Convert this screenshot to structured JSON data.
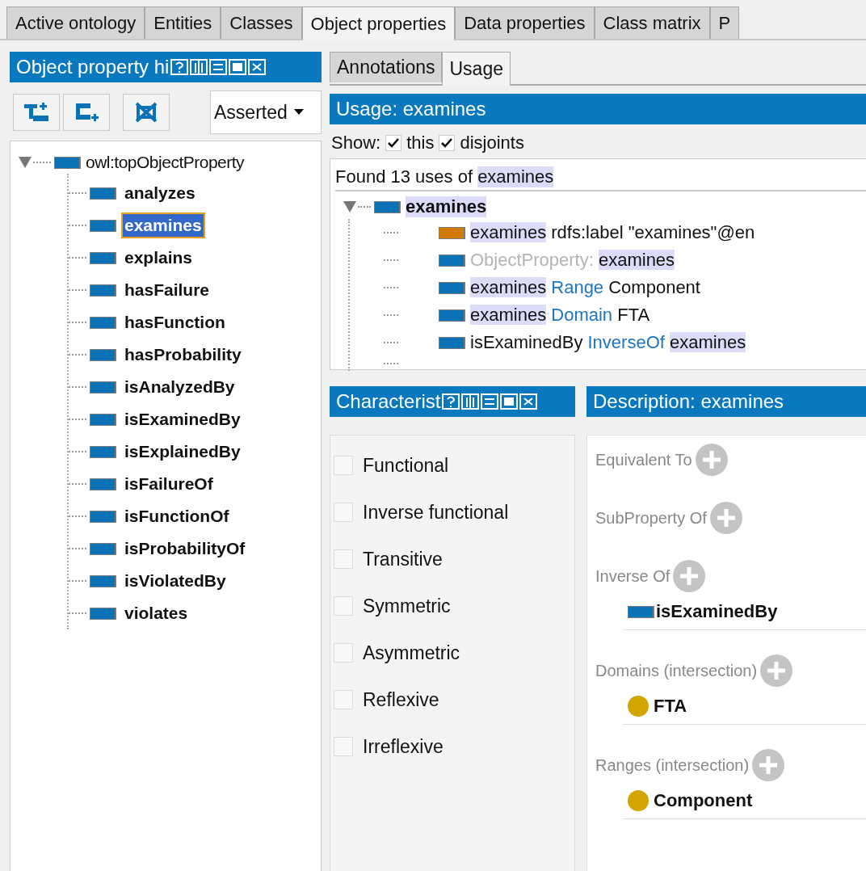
{
  "tabs": [
    {
      "label": "Active ontology",
      "selected": false
    },
    {
      "label": "Entities",
      "selected": false
    },
    {
      "label": "Classes",
      "selected": false
    },
    {
      "label": "Object properties",
      "selected": true
    },
    {
      "label": "Data properties",
      "selected": false
    },
    {
      "label": "Class matrix",
      "selected": false
    },
    {
      "label": "P",
      "selected": false
    }
  ],
  "hierarchy": {
    "title": "Object property hi",
    "view": "Asserted",
    "root": {
      "label": "owl:topObjectProperty",
      "expanded": true,
      "children": [
        {
          "label": "analyzes",
          "selected": false
        },
        {
          "label": "examines",
          "selected": true
        },
        {
          "label": "explains",
          "selected": false
        },
        {
          "label": "hasFailure",
          "selected": false
        },
        {
          "label": "hasFunction",
          "selected": false
        },
        {
          "label": "hasProbability",
          "selected": false
        },
        {
          "label": "isAnalyzedBy",
          "selected": false
        },
        {
          "label": "isExaminedBy",
          "selected": false
        },
        {
          "label": "isExplainedBy",
          "selected": false
        },
        {
          "label": "isFailureOf",
          "selected": false
        },
        {
          "label": "isFunctionOf",
          "selected": false
        },
        {
          "label": "isProbabilityOf",
          "selected": false
        },
        {
          "label": "isViolatedBy",
          "selected": false
        },
        {
          "label": "violates",
          "selected": false
        }
      ]
    }
  },
  "usage_tabs": [
    {
      "label": "Annotations",
      "selected": false
    },
    {
      "label": "Usage",
      "selected": true
    }
  ],
  "usage": {
    "title": "Usage: examines",
    "show_label": "Show:",
    "filters": [
      {
        "label": "this",
        "checked": true
      },
      {
        "label": "disjoints",
        "checked": true
      }
    ],
    "summary": [
      {
        "text": "Found 13 uses of ",
        "kind": "plain"
      },
      {
        "text": "examines",
        "kind": "highlight"
      }
    ],
    "root": {
      "label": "examines",
      "expanded": true,
      "children": [
        {
          "kind": "annotation",
          "parts": [
            {
              "text": "examines",
              "kind": "highlight"
            },
            {
              "text": " rdfs:label \"examines\"@en",
              "kind": "plain"
            }
          ]
        },
        {
          "kind": "property",
          "parts": [
            {
              "text": "ObjectProperty: ",
              "kind": "muted"
            },
            {
              "text": "examines",
              "kind": "highlight"
            }
          ]
        },
        {
          "kind": "property",
          "parts": [
            {
              "text": "examines",
              "kind": "highlight"
            },
            {
              "text": " Range",
              "kind": "keyword"
            },
            {
              "text": " Component",
              "kind": "plain"
            }
          ]
        },
        {
          "kind": "property",
          "parts": [
            {
              "text": "examines",
              "kind": "highlight"
            },
            {
              "text": " Domain",
              "kind": "keyword"
            },
            {
              "text": " FTA",
              "kind": "plain"
            }
          ]
        },
        {
          "kind": "property",
          "parts": [
            {
              "text": "isExaminedBy",
              "kind": "plain"
            },
            {
              "text": " InverseOf ",
              "kind": "keyword"
            },
            {
              "text": "examines",
              "kind": "highlight"
            }
          ]
        }
      ]
    }
  },
  "characteristics": {
    "title": "Characterist",
    "items": [
      {
        "label": "Functional",
        "checked": false
      },
      {
        "label": "Inverse functional",
        "checked": false
      },
      {
        "label": "Transitive",
        "checked": false
      },
      {
        "label": "Symmetric",
        "checked": false
      },
      {
        "label": "Asymmetric",
        "checked": false
      },
      {
        "label": "Reflexive",
        "checked": false
      },
      {
        "label": "Irreflexive",
        "checked": false
      }
    ]
  },
  "description": {
    "title": "Description: examines",
    "sections": [
      {
        "label": "Equivalent To"
      },
      {
        "label": "SubProperty Of"
      },
      {
        "label": "Inverse Of",
        "items": [
          {
            "kind": "property",
            "label": "isExaminedBy"
          }
        ]
      },
      {
        "label": "Domains (intersection)",
        "items": [
          {
            "kind": "class",
            "label": "FTA"
          }
        ]
      },
      {
        "label": "Ranges (intersection)",
        "items": [
          {
            "kind": "class",
            "label": "Component"
          }
        ]
      }
    ]
  }
}
